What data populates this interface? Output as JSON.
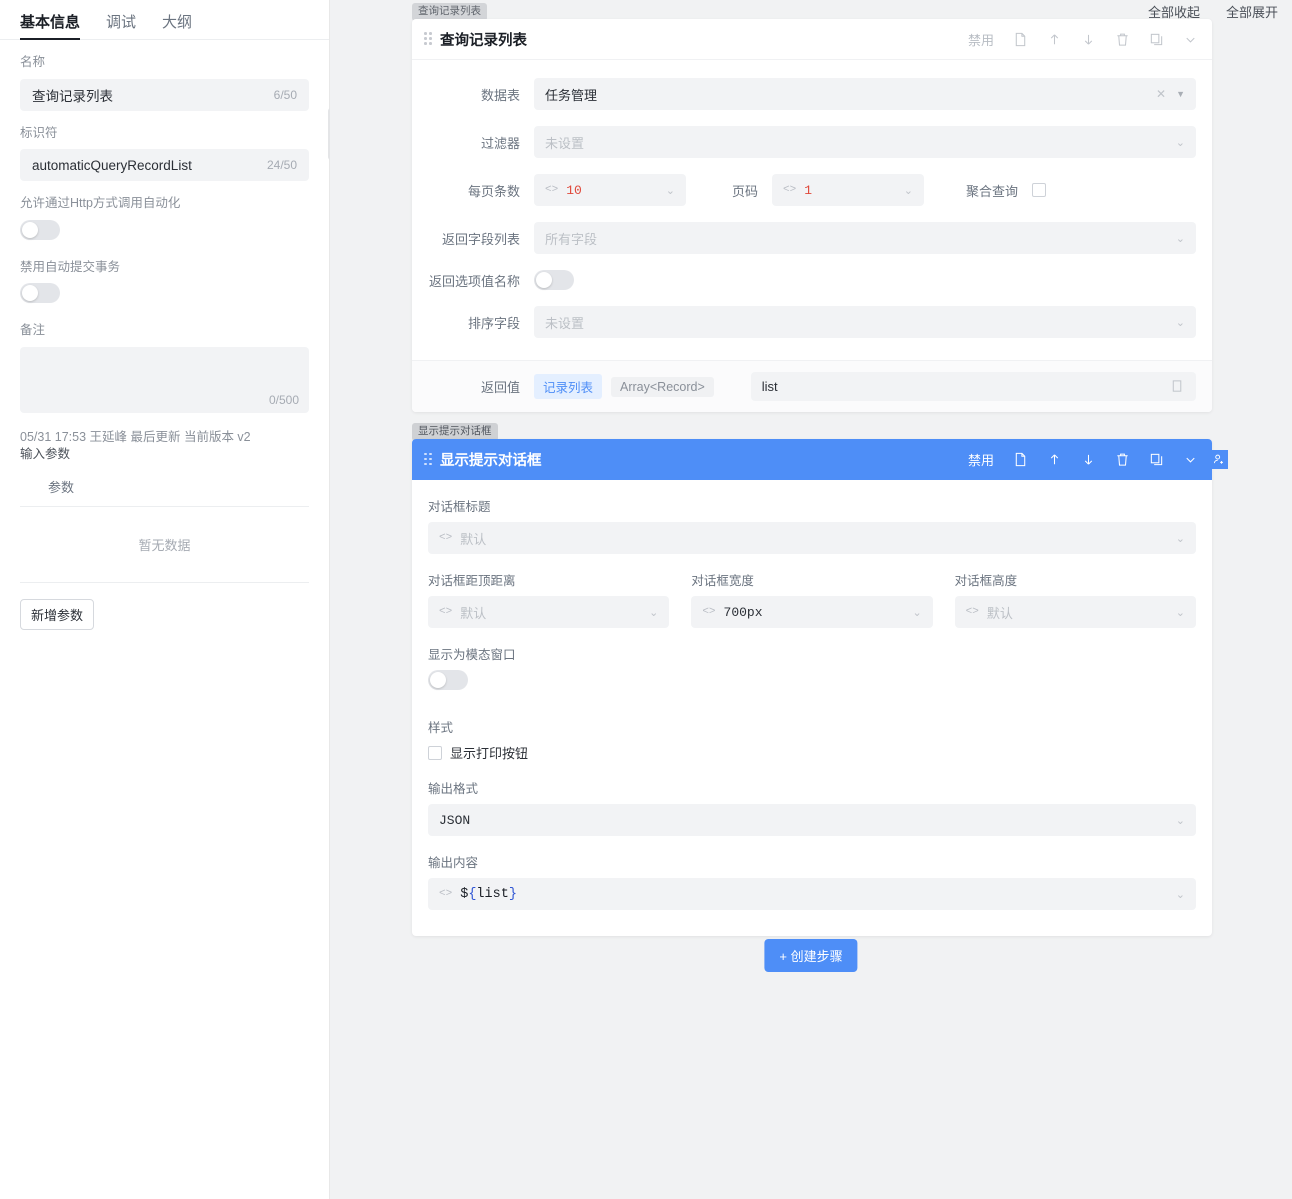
{
  "sidebar": {
    "tabs": [
      {
        "label": "基本信息",
        "active": true
      },
      {
        "label": "调试",
        "active": false
      },
      {
        "label": "大纲",
        "active": false
      }
    ],
    "name_field": {
      "label": "名称",
      "value": "查询记录列表",
      "counter": "6/50"
    },
    "identifier_field": {
      "label": "标识符",
      "value": "automaticQueryRecordList",
      "counter": "24/50"
    },
    "http_toggle": {
      "label": "允许通过Http方式调用自动化",
      "on": false
    },
    "transaction_toggle": {
      "label": "禁用自动提交事务",
      "on": false
    },
    "remark": {
      "label": "备注",
      "value": "",
      "counter": "0/500"
    },
    "meta": "05/31 17:53 王延峰 最后更新 当前版本 v2",
    "input_params_label": "输入参数",
    "param_column": "参数",
    "empty_text": "暂无数据",
    "add_param_button": "新增参数"
  },
  "canvas": {
    "collapse_all": "全部收起",
    "expand_all": "全部展开",
    "create_step_button": "+ 创建步骤"
  },
  "card1": {
    "tag": "查询记录列表",
    "title": "查询记录列表",
    "disable_label": "禁用",
    "fields": {
      "datatable": {
        "label": "数据表",
        "value": "任务管理"
      },
      "filter": {
        "label": "过滤器",
        "placeholder": "未设置"
      },
      "page_size": {
        "label": "每页条数",
        "value": "10"
      },
      "page_number": {
        "label": "页码",
        "value": "1"
      },
      "aggregate": {
        "label": "聚合查询",
        "checked": false
      },
      "return_fields": {
        "label": "返回字段列表",
        "placeholder": "所有字段"
      },
      "return_option_name": {
        "label": "返回选项值名称",
        "on": false
      },
      "sort_field": {
        "label": "排序字段",
        "placeholder": "未设置"
      }
    },
    "return_value": {
      "label": "返回值",
      "chip_name": "记录列表",
      "chip_type": "Array<Record>",
      "variable": "list"
    }
  },
  "card2": {
    "tag": "显示提示对话框",
    "title": "显示提示对话框",
    "disable_label": "禁用",
    "fields": {
      "dialog_title": {
        "label": "对话框标题",
        "placeholder": "默认"
      },
      "dialog_top": {
        "label": "对话框距顶距离",
        "placeholder": "默认"
      },
      "dialog_width": {
        "label": "对话框宽度",
        "value": "700px"
      },
      "dialog_height": {
        "label": "对话框高度",
        "placeholder": "默认"
      },
      "modal": {
        "label": "显示为模态窗口",
        "on": false
      },
      "style_label": "样式",
      "print_button": {
        "label": "显示打印按钮",
        "checked": false
      },
      "output_format": {
        "label": "输出格式",
        "value": "JSON"
      },
      "output_content": {
        "label": "输出内容",
        "value": "${list}"
      }
    }
  },
  "colors": {
    "accent": "#4e8ef7",
    "number": "#e0483a",
    "field_bg": "#f2f3f5",
    "canvas_bg": "#f1f2f3"
  }
}
